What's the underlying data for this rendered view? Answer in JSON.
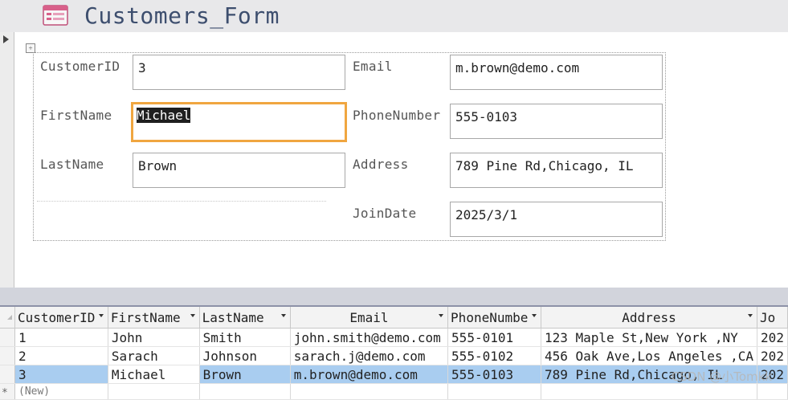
{
  "form": {
    "title": "Customers_Form",
    "fields": {
      "customer_id": {
        "label": "CustomerID",
        "value": "3"
      },
      "first_name": {
        "label": "FirstName",
        "value": "Michael"
      },
      "last_name": {
        "label": "LastName",
        "value": "Brown"
      },
      "email": {
        "label": "Email",
        "value": "m.brown@demo.com"
      },
      "phone": {
        "label": "PhoneNumber",
        "value": "555-0103"
      },
      "address": {
        "label": "Address",
        "value": "789 Pine Rd,Chicago, IL"
      },
      "join_date": {
        "label": "JoinDate",
        "value": "2025/3/1"
      }
    }
  },
  "datasheet": {
    "columns": [
      "CustomerID",
      "FirstName",
      "LastName",
      "Email",
      "PhoneNumbe",
      "Address",
      "Jo"
    ],
    "rows": [
      [
        "1",
        "John",
        "Smith",
        "john.smith@demo.com",
        "555-0101",
        "123 Maple St,New York ,NY",
        "202"
      ],
      [
        "2",
        "Sarach",
        "Johnson",
        "sarach.j@demo.com",
        "555-0102",
        "456 Oak Ave,Los Angeles ,CA",
        "202"
      ],
      [
        "3",
        "Michael",
        "Brown",
        "m.brown@demo.com",
        "555-0103",
        "789 Pine Rd,Chicago, IL",
        "202"
      ]
    ],
    "new_row_label": "(New)",
    "new_row_marker": "*"
  },
  "watermark": "CSDN @小Tomkk",
  "colors": {
    "title_text": "#3d4e6e",
    "focus_border": "#f0a640",
    "current_row": "#a9cdf0",
    "splitter": "#d2d4dc"
  },
  "icons": {
    "form": "form-icon",
    "record_selector": "record-arrow-icon",
    "layout_selector": "layout-move-icon",
    "dropdown": "dropdown-arrow-icon"
  }
}
